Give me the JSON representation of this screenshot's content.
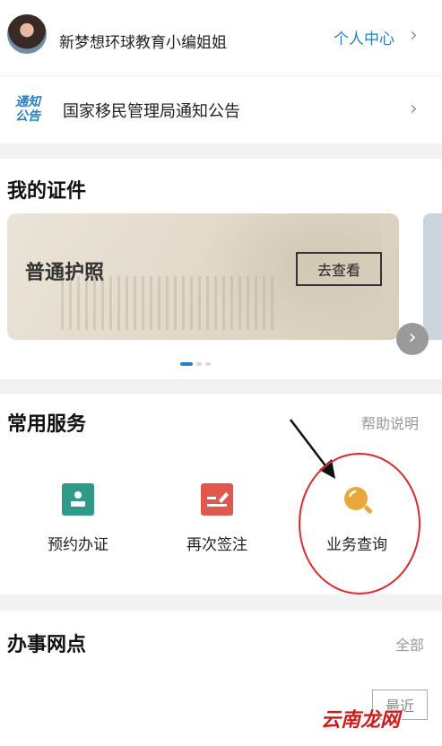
{
  "colors": {
    "accent_blue": "#2a7fc4",
    "teal": "#2f9a88",
    "coral": "#e2574c",
    "gold": "#e8a93a",
    "annotation_red": "#e0282d",
    "watermark_red": "#d11a1a"
  },
  "header": {
    "user_name": "新梦想环球教育小编姐姐",
    "personal_center_label": "个人中心",
    "chevron": "›"
  },
  "notice": {
    "badge_line1": "通知",
    "badge_line2": "公告",
    "text": "国家移民管理局通知公告",
    "chevron": "›"
  },
  "documents": {
    "title": "我的证件",
    "card_title": "普通护照",
    "view_button": "去查看",
    "carousel_arrow": "›"
  },
  "services": {
    "title": "常用服务",
    "help_label": "帮助说明",
    "items": [
      {
        "label": "预约办证",
        "icon": "id-card-icon"
      },
      {
        "label": "再次签注",
        "icon": "sign-pen-icon"
      },
      {
        "label": "业务查询",
        "icon": "magnifier-icon"
      }
    ]
  },
  "outlets": {
    "title": "办事网点",
    "all_label": "全部",
    "recent_button": "最近"
  },
  "watermark": "云南龙网"
}
